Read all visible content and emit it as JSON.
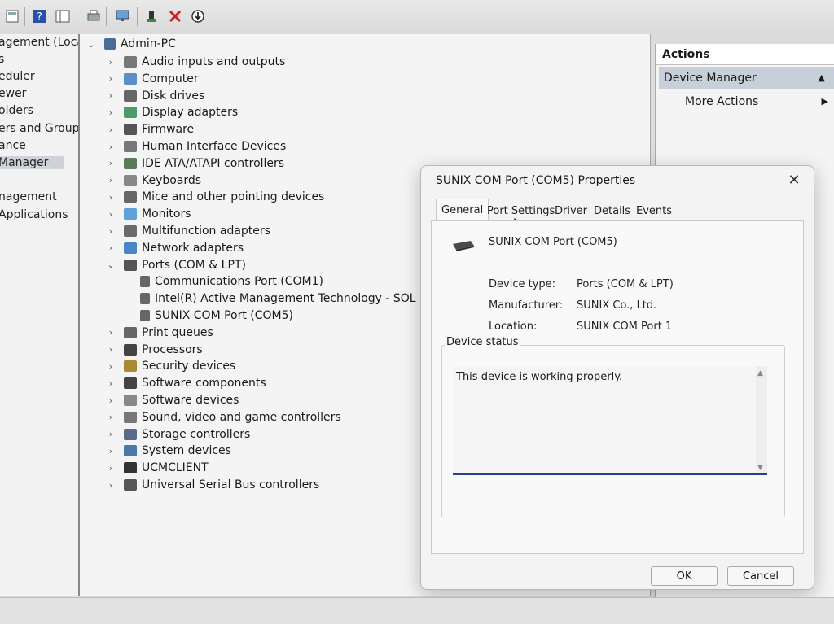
{
  "toolbar": {
    "icons": [
      "console-icon",
      "show-hide-tree-icon",
      "help-icon",
      "properties-icon",
      "print-icon",
      "scan-hardware-icon",
      "update-driver-icon",
      "uninstall-icon",
      "disable-icon"
    ]
  },
  "left_nav": {
    "items": [
      {
        "label": "agement (Local"
      },
      {
        "label": "s"
      },
      {
        "label": "eduler"
      },
      {
        "label": "ewer"
      },
      {
        "label": "olders"
      },
      {
        "label": "ers and Groups"
      },
      {
        "label": "ance"
      },
      {
        "label": "Manager",
        "selected": true
      },
      {
        "label": ""
      },
      {
        "label": "nagement"
      },
      {
        "label": " Applications"
      }
    ]
  },
  "tree": {
    "root": "Admin-PC",
    "categories": [
      {
        "label": "Audio inputs and outputs",
        "icon": "speaker-icon"
      },
      {
        "label": "Computer",
        "icon": "computer-icon"
      },
      {
        "label": "Disk drives",
        "icon": "disk-drive-icon"
      },
      {
        "label": "Display adapters",
        "icon": "display-adapter-icon"
      },
      {
        "label": "Firmware",
        "icon": "firmware-icon"
      },
      {
        "label": "Human Interface Devices",
        "icon": "hid-icon"
      },
      {
        "label": "IDE ATA/ATAPI controllers",
        "icon": "ide-controller-icon"
      },
      {
        "label": "Keyboards",
        "icon": "keyboard-icon"
      },
      {
        "label": "Mice and other pointing devices",
        "icon": "mouse-icon"
      },
      {
        "label": "Monitors",
        "icon": "monitor-icon"
      },
      {
        "label": "Multifunction adapters",
        "icon": "multifunction-icon"
      },
      {
        "label": "Network adapters",
        "icon": "network-adapter-icon"
      },
      {
        "label": "Ports (COM & LPT)",
        "icon": "port-icon",
        "expanded": true
      },
      {
        "label": "Print queues",
        "icon": "printer-icon"
      },
      {
        "label": "Processors",
        "icon": "processor-icon"
      },
      {
        "label": "Security devices",
        "icon": "security-icon"
      },
      {
        "label": "Software components",
        "icon": "software-component-icon"
      },
      {
        "label": "Software devices",
        "icon": "software-device-icon"
      },
      {
        "label": "Sound, video and game controllers",
        "icon": "sound-icon"
      },
      {
        "label": "Storage controllers",
        "icon": "storage-icon"
      },
      {
        "label": "System devices",
        "icon": "system-device-icon"
      },
      {
        "label": "UCMCLIENT",
        "icon": "ucm-icon"
      },
      {
        "label": "Universal Serial Bus controllers",
        "icon": "usb-icon"
      }
    ],
    "ports_children": [
      "Communications Port (COM1)",
      "Intel(R) Active Management Technology - SOL (COM",
      "SUNIX COM Port (COM5)"
    ]
  },
  "actions": {
    "header": "Actions",
    "section": "Device Manager",
    "more": "More Actions"
  },
  "dialog": {
    "title": "SUNIX COM Port (COM5) Properties",
    "tabs": [
      "General",
      "Port Settings",
      "Driver",
      "Details",
      "Events"
    ],
    "active_tab": "General",
    "device_name": "SUNIX COM Port (COM5)",
    "fields": [
      {
        "label": "Device type:",
        "value": "Ports (COM & LPT)"
      },
      {
        "label": "Manufacturer:",
        "value": "SUNIX Co., Ltd."
      },
      {
        "label": "Location:",
        "value": "SUNIX COM Port 1"
      }
    ],
    "status_label": "Device status",
    "status_text": "This device is working properly.",
    "ok": "OK",
    "cancel": "Cancel"
  }
}
